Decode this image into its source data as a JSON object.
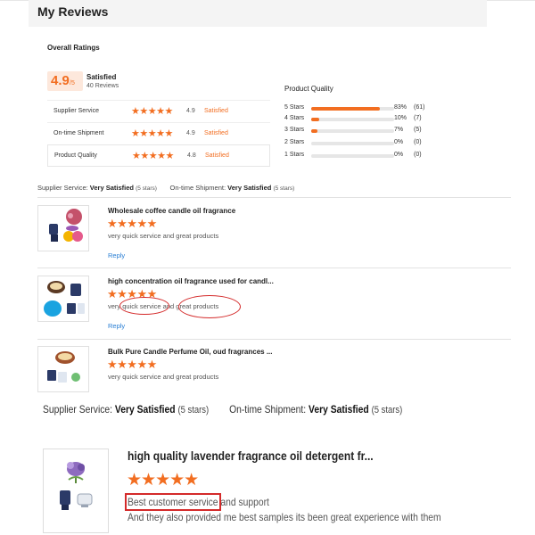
{
  "header": {
    "title": "My Reviews"
  },
  "overall": {
    "heading": "Overall Ratings",
    "score": "4.9",
    "score_suffix": "/5",
    "status": "Satisfied",
    "review_count": "40 Reviews",
    "sub_ratings": [
      {
        "label": "Supplier Service",
        "stars": "★★★★★",
        "score": "4.9",
        "status": "Satisfied"
      },
      {
        "label": "On-time Shipment",
        "stars": "★★★★★",
        "score": "4.9",
        "status": "Satisfied"
      },
      {
        "label": "Product Quality",
        "stars": "★★★★★",
        "score": "4.8",
        "status": "Satisfied"
      }
    ],
    "quality": {
      "heading": "Product Quality",
      "distribution": [
        {
          "label": "5 Stars",
          "percent": 83,
          "percent_text": "83%",
          "count": "(61)"
        },
        {
          "label": "4 Stars",
          "percent": 10,
          "percent_text": "10%",
          "count": "(7)"
        },
        {
          "label": "3 Stars",
          "percent": 7,
          "percent_text": "7%",
          "count": "(5)"
        },
        {
          "label": "2 Stars",
          "percent": 0,
          "percent_text": "0%",
          "count": "(0)"
        },
        {
          "label": "1 Stars",
          "percent": 0,
          "percent_text": "0%",
          "count": "(0)"
        }
      ]
    }
  },
  "summary": {
    "supplier_label": "Supplier Service:",
    "supplier_value": "Very Satisfied",
    "supplier_stars": "(5 stars)",
    "shipment_label": "On-time Shipment:",
    "shipment_value": "Very Satisfied",
    "shipment_stars": "(5 stars)"
  },
  "reviews": [
    {
      "title": "Wholesale coffee candle oil fragrance",
      "stars": "★★★★★",
      "text": "very quick service and great products",
      "reply": "Reply"
    },
    {
      "title": "high concentration oil fragrance used for candl...",
      "stars": "★★★★★",
      "text": "very quick service and great products",
      "reply": "Reply"
    },
    {
      "title": "Bulk Pure Candle Perfume Oil, oud fragrances ...",
      "stars": "★★★★★",
      "text": "very quick service and great products"
    }
  ],
  "featured_review": {
    "title": "high quality lavender fragrance oil detergent fr...",
    "stars": "★★★★★",
    "line1_highlight": "Best customer service",
    "line1_rest": " and support",
    "line2": "And they also provided me best samples  its been great experience with them"
  },
  "colors": {
    "accent": "#f26e21",
    "link": "#2a7fd4",
    "annotation": "#d42a2a"
  }
}
